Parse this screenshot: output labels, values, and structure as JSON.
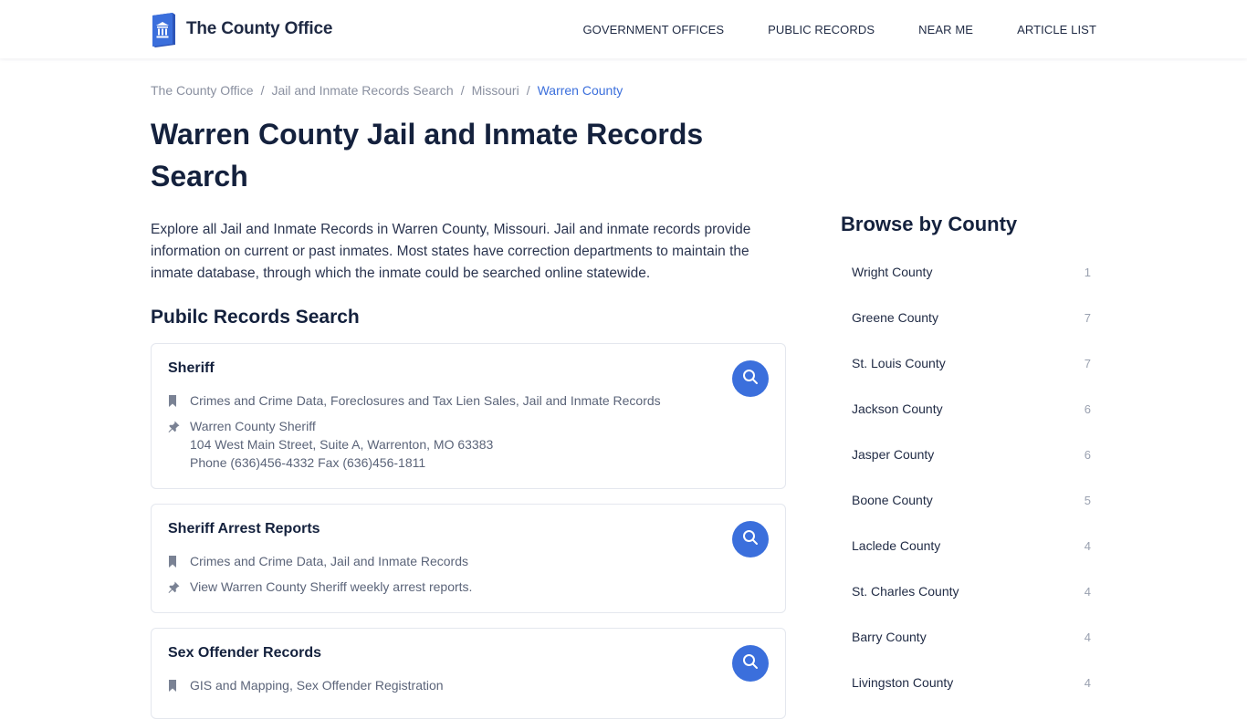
{
  "site": {
    "logo_text": "The County Office",
    "nav": [
      "GOVERNMENT OFFICES",
      "PUBLIC RECORDS",
      "NEAR ME",
      "ARTICLE LIST"
    ]
  },
  "breadcrumb": [
    "The County Office",
    "Jail and Inmate Records Search",
    "Missouri",
    "Warren County"
  ],
  "page": {
    "title": "Warren County Jail and Inmate Records Search",
    "intro": "Explore all Jail and Inmate Records in Warren County, Missouri. Jail and inmate records provide information on current or past inmates. Most states have correction departments to maintain the inmate database, through which the inmate could be searched online statewide.",
    "section_title": "Pubilc Records Search"
  },
  "records": [
    {
      "title": "Sheriff",
      "categories": "Crimes and Crime Data, Foreclosures and Tax Lien Sales, Jail and Inmate Records",
      "details": [
        "Warren County Sheriff",
        "104 West Main Street, Suite A, Warrenton, MO 63383",
        "Phone (636)456-4332 Fax (636)456-1811"
      ]
    },
    {
      "title": "Sheriff Arrest Reports",
      "categories": "Crimes and Crime Data, Jail and Inmate Records",
      "details": [
        "View Warren County Sheriff weekly arrest reports."
      ]
    },
    {
      "title": "Sex Offender Records",
      "categories": "GIS and Mapping, Sex Offender Registration",
      "details": []
    }
  ],
  "sidebar": {
    "title": "Browse by County",
    "counties": [
      {
        "name": "Wright County",
        "count": "1"
      },
      {
        "name": "Greene County",
        "count": "7"
      },
      {
        "name": "St. Louis County",
        "count": "7"
      },
      {
        "name": "Jackson County",
        "count": "6"
      },
      {
        "name": "Jasper County",
        "count": "6"
      },
      {
        "name": "Boone County",
        "count": "5"
      },
      {
        "name": "Laclede County",
        "count": "4"
      },
      {
        "name": "St. Charles County",
        "count": "4"
      },
      {
        "name": "Barry County",
        "count": "4"
      },
      {
        "name": "Livingston County",
        "count": "4"
      }
    ]
  },
  "colors": {
    "accent": "#3b6fdc",
    "heading": "#14213d",
    "muted": "#8a90a0"
  },
  "icons": {
    "search": "search-icon",
    "category": "bookmark-icon",
    "detail": "pin-icon",
    "logo": "courthouse-book-icon"
  }
}
